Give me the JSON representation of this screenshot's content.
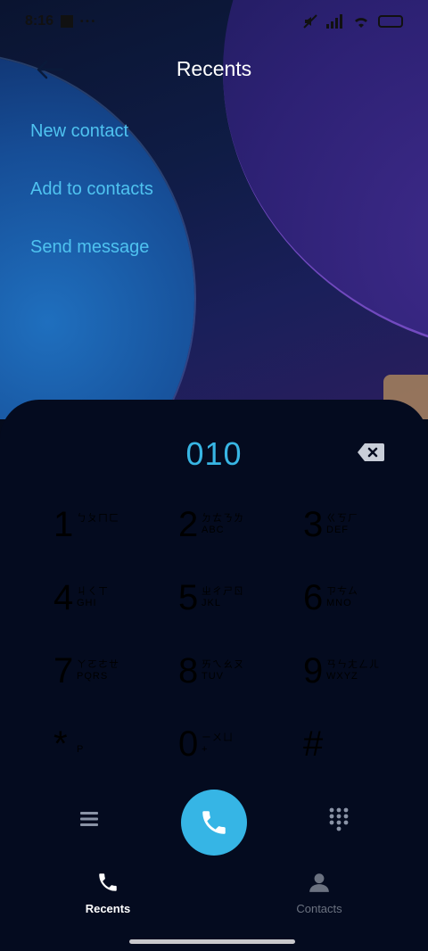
{
  "status_bar": {
    "time": "8:16",
    "dots": "• • •"
  },
  "header": {
    "title": "Recents"
  },
  "actions": [
    {
      "label": "New contact"
    },
    {
      "label": "Add to contacts"
    },
    {
      "label": "Send message"
    }
  ],
  "dialpad": {
    "number": "010",
    "keys": [
      {
        "digit": "1",
        "sub1": "ㄅㄆㄇㄈ",
        "sub2": ""
      },
      {
        "digit": "2",
        "sub1": "ㄉㄊㄋㄌ",
        "sub2": "ABC"
      },
      {
        "digit": "3",
        "sub1": "ㄍㄎㄏ",
        "sub2": "DEF"
      },
      {
        "digit": "4",
        "sub1": "ㄐㄑㄒ",
        "sub2": "GHI"
      },
      {
        "digit": "5",
        "sub1": "ㄓㄔㄕㄖ",
        "sub2": "JKL"
      },
      {
        "digit": "6",
        "sub1": "ㄗㄘㄙ",
        "sub2": "MNO"
      },
      {
        "digit": "7",
        "sub1": "ㄚㄛㄜㄝ",
        "sub2": "PQRS"
      },
      {
        "digit": "8",
        "sub1": "ㄞㄟㄠㄡ",
        "sub2": "TUV"
      },
      {
        "digit": "9",
        "sub1": "ㄢㄣㄤㄥㄦ",
        "sub2": "WXYZ"
      },
      {
        "digit": "*",
        "sub1": "",
        "sub2": "P"
      },
      {
        "digit": "0",
        "sub1": "ㄧㄨㄩ",
        "sub2": "+"
      },
      {
        "digit": "#",
        "sub1": "",
        "sub2": ""
      }
    ]
  },
  "nav": {
    "recents": "Recents",
    "contacts": "Contacts"
  },
  "colors": {
    "accent": "#36b5e5",
    "link": "#4fc3f0",
    "panel": "#040b1f"
  },
  "icons": [
    "back-arrow-icon",
    "backspace-icon",
    "menu-icon",
    "phone-icon",
    "dialpad-icon",
    "contact-icon"
  ]
}
